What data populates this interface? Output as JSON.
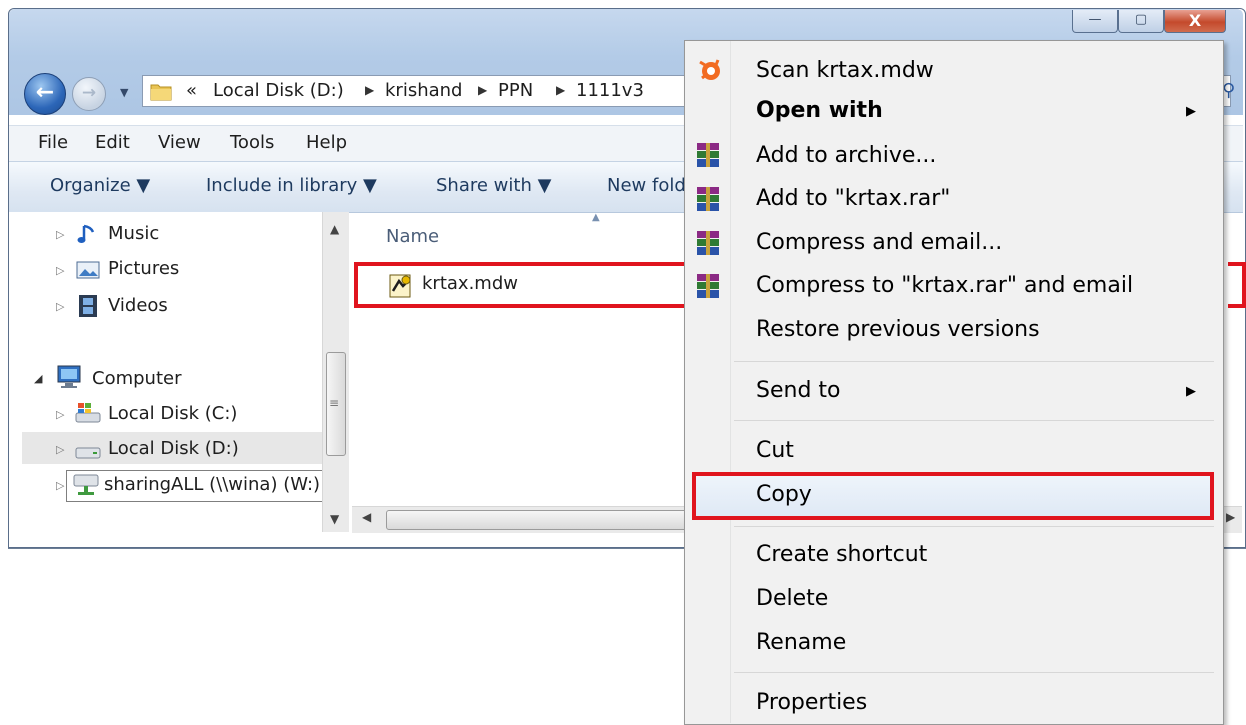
{
  "window": {
    "breadcrumb": {
      "overflow": "«",
      "items": [
        "Local Disk (D:)",
        "krishand",
        "PPN",
        "1111v3"
      ]
    },
    "caption_buttons": {
      "minimize": "—",
      "maximize": "▢",
      "close": "X"
    }
  },
  "menubar": {
    "items": [
      "File",
      "Edit",
      "View",
      "Tools",
      "Help"
    ]
  },
  "toolbar": {
    "organize": "Organize ▼",
    "include": "Include in library ▼",
    "share": "Share with ▼",
    "newfolder": "New fold"
  },
  "nav_tree": {
    "music": "Music",
    "pictures": "Pictures",
    "videos": "Videos",
    "computer": "Computer",
    "disk_c": "Local Disk (C:)",
    "disk_d": "Local Disk (D:)",
    "share_w": "sharingALL (\\\\wina) (W:)"
  },
  "file_list": {
    "column_header": "Name",
    "files": [
      {
        "name": "krtax.mdw",
        "icon": "access-workgroup-icon"
      }
    ]
  },
  "context_menu": {
    "items": {
      "scan": "Scan krtax.mdw",
      "open_with": "Open with",
      "add_archive": "Add to archive...",
      "add_rar": "Add to \"krtax.rar\"",
      "compress_email": "Compress and email...",
      "compress_rar_email": "Compress to \"krtax.rar\" and email",
      "restore": "Restore previous versions",
      "send_to": "Send to",
      "cut": "Cut",
      "copy": "Copy",
      "shortcut": "Create shortcut",
      "delete": "Delete",
      "rename": "Rename",
      "properties": "Properties"
    },
    "highlighted": "Copy"
  },
  "colors": {
    "highlight_box": "#e0141e",
    "window_frame": "#b3cbe7",
    "menu_bg": "#f1f1f1"
  }
}
